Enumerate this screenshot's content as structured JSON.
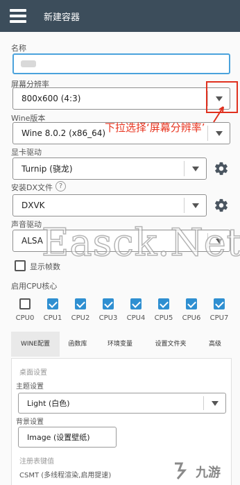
{
  "topbar": {
    "title": "新建容器",
    "menu_icon": "hamburger-menu-icon",
    "color": "#3c4d5b"
  },
  "form": {
    "name": {
      "label": "名称",
      "value": ""
    },
    "resolution": {
      "label": "屏幕分辨率",
      "value": "800x600 (4:3)"
    },
    "wine": {
      "label": "Wine版本",
      "value": "Wine 8.0.2 (x86_64)"
    },
    "gpu": {
      "label": "显卡驱动",
      "value": "Turnip (骁龙)"
    },
    "dx": {
      "label": "安装DX文件",
      "value": "DXVK"
    },
    "audio": {
      "label": "声音驱动",
      "value": "ALSA"
    },
    "fps": {
      "label": "显示帧数",
      "checked": false
    }
  },
  "cpu": {
    "label": "启用CPU核心",
    "cores": [
      {
        "name": "CPU0",
        "checked": false
      },
      {
        "name": "CPU1",
        "checked": true
      },
      {
        "name": "CPU2",
        "checked": true
      },
      {
        "name": "CPU3",
        "checked": true
      },
      {
        "name": "CPU4",
        "checked": true
      },
      {
        "name": "CPU5",
        "checked": true
      },
      {
        "name": "CPU6",
        "checked": true
      },
      {
        "name": "CPU7",
        "checked": true
      }
    ]
  },
  "tabs": [
    "WINE配置",
    "函数库",
    "环境变量",
    "设置文件夹",
    "高级"
  ],
  "active_tab": 0,
  "wine_config": {
    "desktop_section": "桌面设置",
    "theme_label": "主题设置",
    "theme_value": "Light (白色)",
    "background_label": "背景设置",
    "background_value": "Image (设置壁纸)",
    "registry_section": "注册表键值",
    "csmt_label": "CSMT (多线程渲染,启用提速)"
  },
  "annotation": {
    "text": "下拉选择‘屏幕分辨率’",
    "color": "#e8341f"
  },
  "watermark": "Easck.Net",
  "logo": "九游",
  "accent_color": "#2f8fd1"
}
